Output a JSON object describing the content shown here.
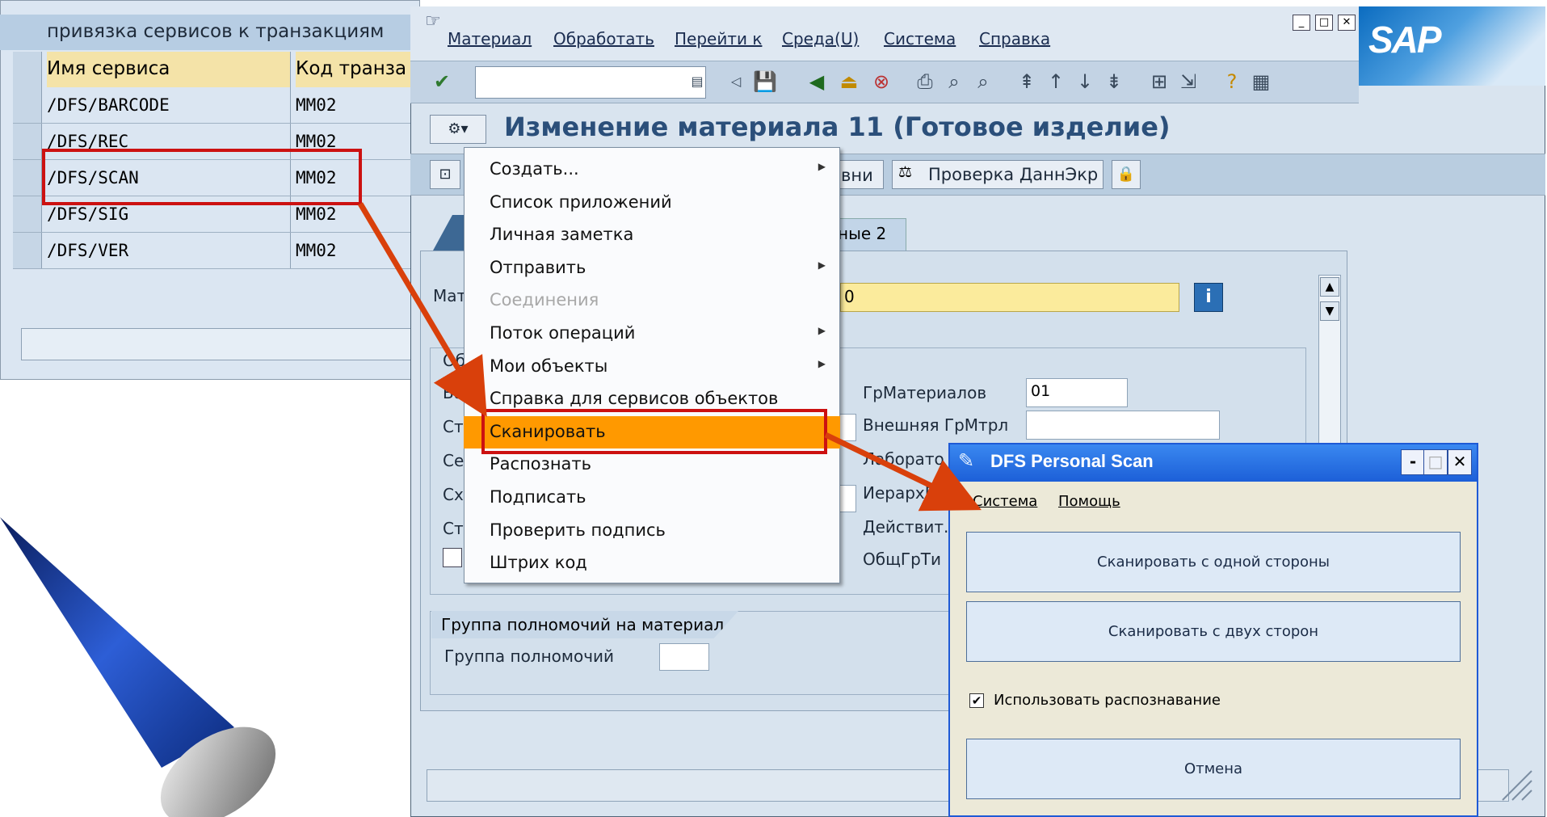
{
  "left_table": {
    "title": "привязка сервисов к транзакциям",
    "headers": [
      "Имя сервиса",
      "Код транза"
    ],
    "rows": [
      {
        "service": "/DFS/BARCODE",
        "code": "MM02"
      },
      {
        "service": "/DFS/REC",
        "code": "MM02"
      },
      {
        "service": "/DFS/SCAN",
        "code": "MM02"
      },
      {
        "service": "/DFS/SIG",
        "code": "MM02"
      },
      {
        "service": "/DFS/VER",
        "code": "MM02"
      }
    ]
  },
  "sap": {
    "menu": [
      "Материал",
      "Обработать",
      "Перейти к",
      "Среда(U)",
      "Система",
      "Справка"
    ],
    "logo": "SAP",
    "title": "Изменение материала 11 (Готовое изделие)",
    "app_toolbar": {
      "partial_button": "вни",
      "check_button": "Проверка ДаннЭкр"
    },
    "tab_partial": "ные 2",
    "material_label_partial": "Мат",
    "material_value_partial": "0",
    "fields": [
      {
        "label": "ГрМатериалов",
        "value": "01"
      },
      {
        "label": "Внешняя ГрМтрл",
        "value": ""
      },
      {
        "label": "Лаборато",
        "value": ""
      },
      {
        "label": "ИерархП",
        "value": ""
      },
      {
        "label": "Действит.",
        "value": ""
      },
      {
        "label": "ОбщГрТи",
        "value": ""
      }
    ],
    "left_labels_partial": [
      "Об",
      "Ба",
      "Ст",
      "Се",
      "Сх",
      "Ст"
    ],
    "auth_group": {
      "header": "Группа полномочий на материал",
      "label": "Группа полномочий"
    }
  },
  "context_menu": [
    {
      "label": "Создать...",
      "submenu": true,
      "disabled": false
    },
    {
      "label": "Список приложений",
      "submenu": false,
      "disabled": false
    },
    {
      "label": "Личная заметка",
      "submenu": false,
      "disabled": false
    },
    {
      "label": "Отправить",
      "submenu": true,
      "disabled": false
    },
    {
      "label": "Соединения",
      "submenu": false,
      "disabled": true
    },
    {
      "label": "Поток операций",
      "submenu": true,
      "disabled": false
    },
    {
      "label": "Мои объекты",
      "submenu": true,
      "disabled": false
    },
    {
      "label": "Справка для сервисов объектов",
      "submenu": false,
      "disabled": false
    },
    {
      "label": "Сканировать",
      "submenu": false,
      "disabled": false,
      "highlighted": true
    },
    {
      "label": "Распознать",
      "submenu": false,
      "disabled": false
    },
    {
      "label": "Подписать",
      "submenu": false,
      "disabled": false
    },
    {
      "label": "Проверить подпись",
      "submenu": false,
      "disabled": false
    },
    {
      "label": "Штрих код",
      "submenu": false,
      "disabled": false
    }
  ],
  "dfs_dialog": {
    "title": "DFS Personal Scan",
    "menu": [
      "Система",
      "Помощь"
    ],
    "buttons": [
      "Сканировать с одной стороны",
      "Сканировать с двух сторон",
      "Отмена"
    ],
    "checkbox": {
      "label": "Использовать распознавание",
      "checked": true
    }
  },
  "colors": {
    "highlight": "#ff9900",
    "annotation": "#cc1111",
    "arrow": "#d9400b",
    "title_blue": "#2b4f7a",
    "xp_title": "#1c5fd8"
  }
}
